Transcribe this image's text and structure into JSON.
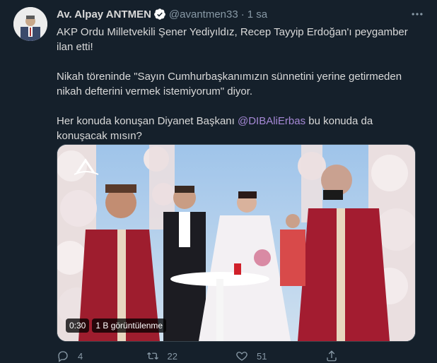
{
  "tweet": {
    "author_name": "Av. Alpay ANTMEN",
    "handle": "@avantmen33",
    "separator": "·",
    "time": "1 sa",
    "text_line1": "AKP Ordu Milletvekili Şener Yediyıldız, Recep Tayyip Erdoğan'ı peygamber ilan etti!",
    "text_line2": "Nikah töreninde \"Sayın Cumhurbaşkanımızın sünnetini yerine getirmeden nikah defterini vermek istemiyorum\" diyor.",
    "text_line3_pre": "Her konuda konuşan Diyanet Başkanı ",
    "mention": "@DIBAliErbas",
    "text_line3_post": " bu konuda da konuşacak mısın?",
    "icons": {
      "verified": "verified-badge-icon",
      "more": "more-options-icon",
      "reply": "reply-icon",
      "retweet": "retweet-icon",
      "like": "like-icon",
      "share": "share-icon"
    }
  },
  "video": {
    "duration": "0:30",
    "views": "1 B görüntülenme"
  },
  "actions": {
    "reply_count": "4",
    "retweet_count": "22",
    "like_count": "51"
  },
  "colors": {
    "background": "#15202b",
    "text": "#d9d9d9",
    "secondary": "#8899a6",
    "mention": "#a689d6",
    "verified": "#ffffff"
  }
}
